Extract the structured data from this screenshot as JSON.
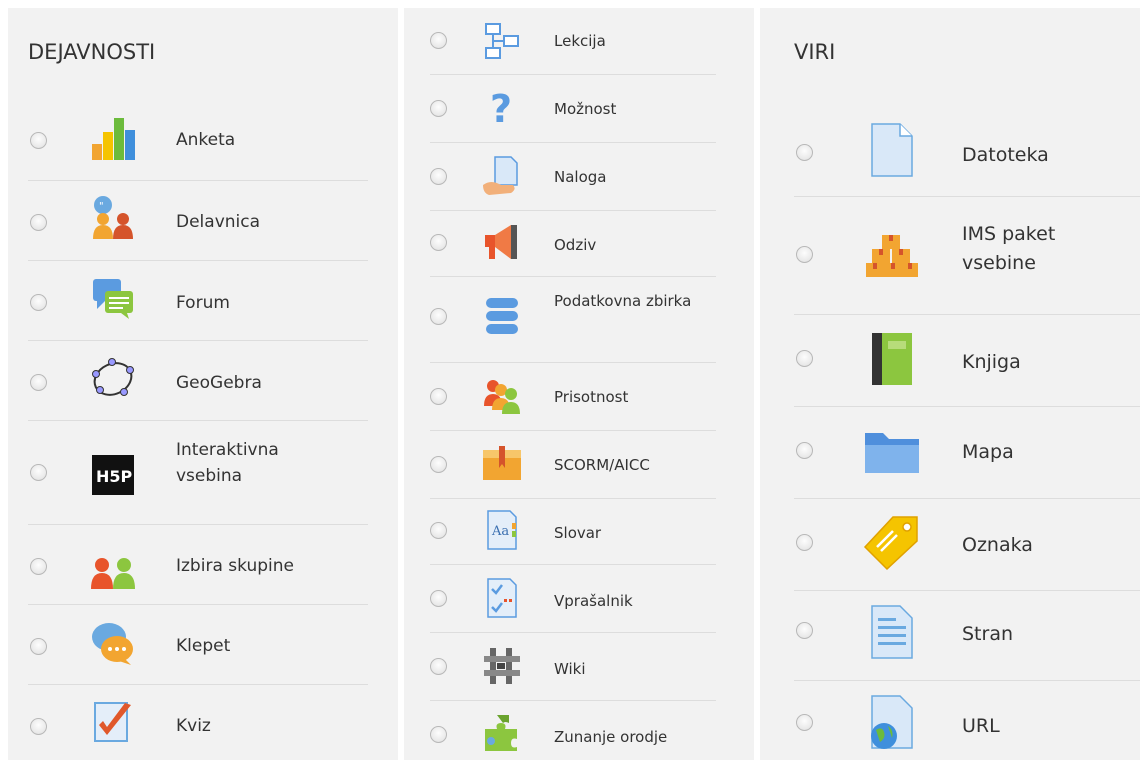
{
  "activities": {
    "heading": "DEJAVNOSTI",
    "items": [
      {
        "label": "Anketa",
        "icon": "bar-chart-icon"
      },
      {
        "label": "Delavnica",
        "icon": "workshop-icon"
      },
      {
        "label": "Forum",
        "icon": "forum-icon"
      },
      {
        "label": "GeoGebra",
        "icon": "geogebra-icon"
      },
      {
        "label": "Interaktivna vsebina",
        "icon": "h5p-icon"
      },
      {
        "label": "Izbira skupine",
        "icon": "group-choice-icon"
      },
      {
        "label": "Klepet",
        "icon": "chat-icon"
      },
      {
        "label": "Kviz",
        "icon": "quiz-icon"
      }
    ]
  },
  "activities_more": {
    "items": [
      {
        "label": "Lekcija",
        "icon": "lesson-icon"
      },
      {
        "label": "Možnost",
        "icon": "question-icon"
      },
      {
        "label": "Naloga",
        "icon": "assignment-icon"
      },
      {
        "label": "Odziv",
        "icon": "megaphone-icon"
      },
      {
        "label": "Podatkovna zbirka",
        "icon": "database-icon"
      },
      {
        "label": "Prisotnost",
        "icon": "attendance-icon"
      },
      {
        "label": "SCORM/AICC",
        "icon": "scorm-icon"
      },
      {
        "label": "Slovar",
        "icon": "glossary-icon"
      },
      {
        "label": "Vprašalnik",
        "icon": "questionnaire-icon"
      },
      {
        "label": "Wiki",
        "icon": "wiki-icon"
      },
      {
        "label": "Zunanje orodje",
        "icon": "puzzle-icon"
      }
    ]
  },
  "resources": {
    "heading": "VIRI",
    "items": [
      {
        "label": "Datoteka",
        "icon": "file-icon"
      },
      {
        "label": "IMS paket vsebine",
        "icon": "ims-package-icon"
      },
      {
        "label": "Knjiga",
        "icon": "book-icon"
      },
      {
        "label": "Mapa",
        "icon": "folder-icon"
      },
      {
        "label": "Oznaka",
        "icon": "tag-icon"
      },
      {
        "label": "Stran",
        "icon": "page-icon"
      },
      {
        "label": "URL",
        "icon": "url-icon"
      }
    ]
  }
}
